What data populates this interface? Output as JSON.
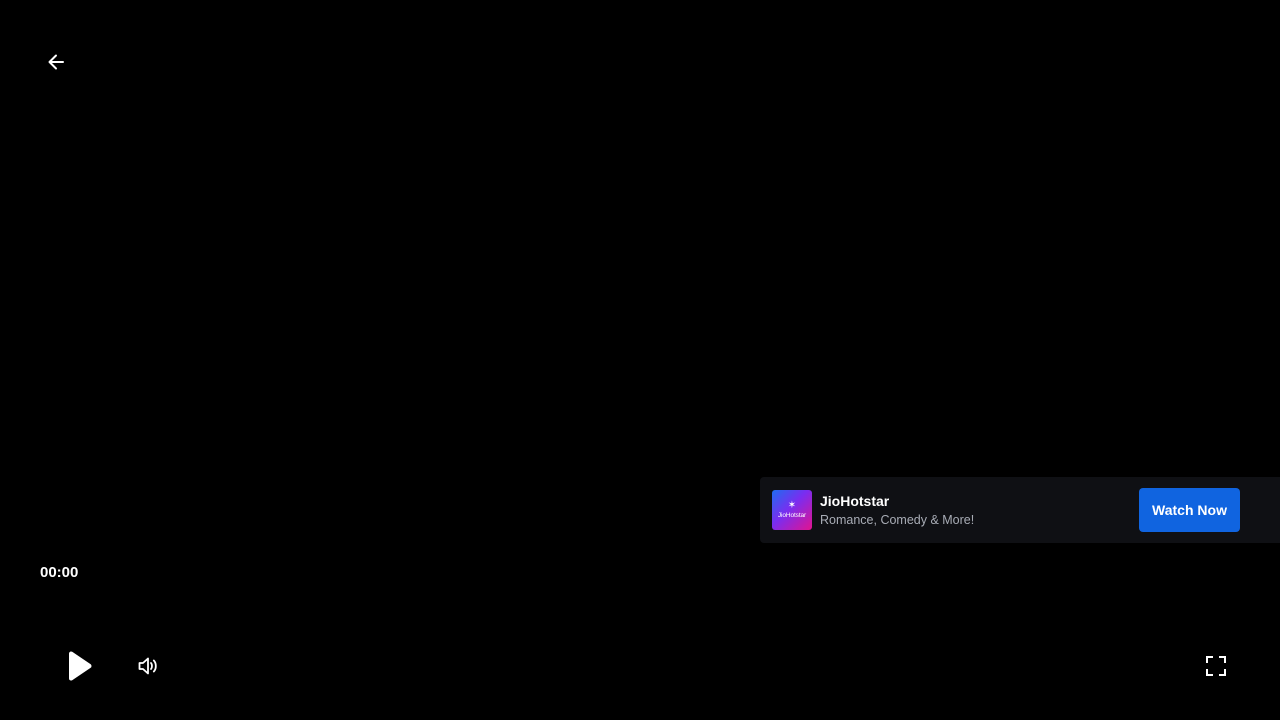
{
  "player": {
    "current_time": "00:00",
    "background_color": "#000000"
  },
  "controls": {
    "back_icon": "arrow-left-icon",
    "play_icon": "play-icon",
    "volume_icon": "volume-icon",
    "fullscreen_icon": "fullscreen-icon"
  },
  "ad": {
    "logo_text": "JioHotstar",
    "title": "JioHotstar",
    "subtitle": "Romance, Comedy & More!",
    "cta_label": "Watch Now",
    "cta_color": "#1064e0",
    "banner_color": "#0f1014"
  }
}
